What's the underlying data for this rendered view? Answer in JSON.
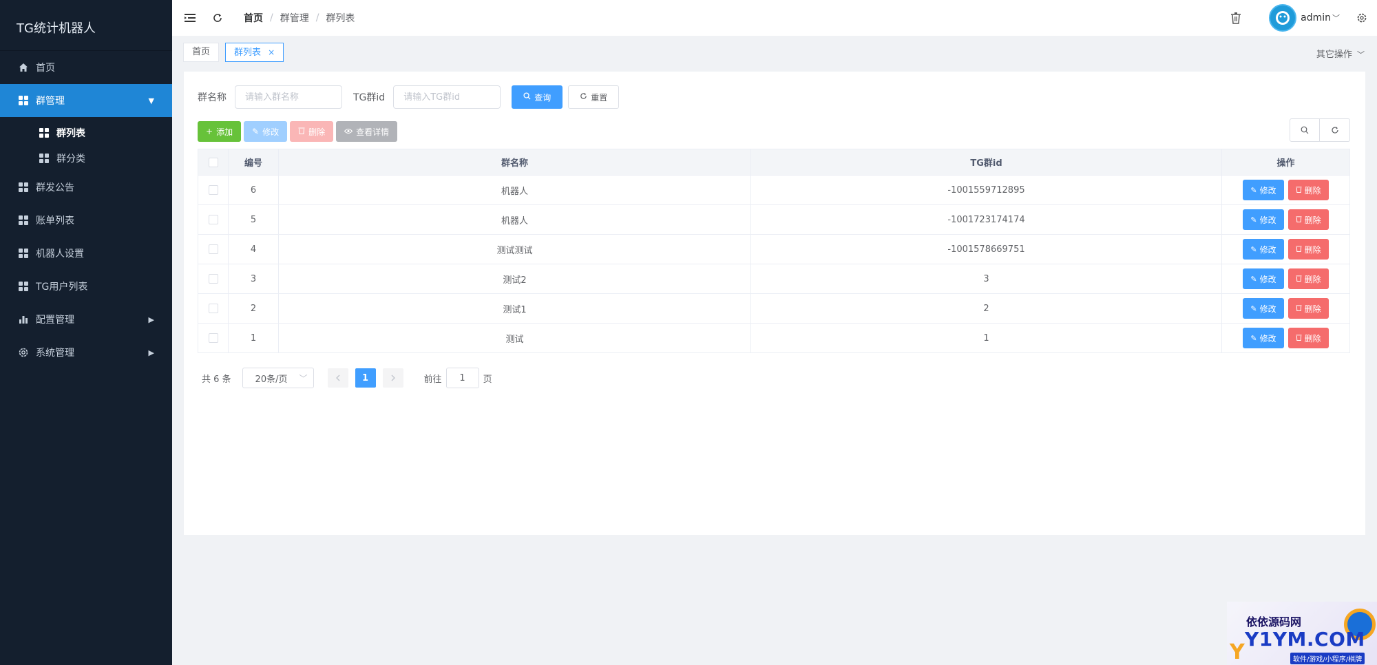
{
  "app": {
    "title": "TG统计机器人"
  },
  "sidebar": {
    "items": [
      {
        "label": "首页",
        "icon": "home-icon"
      },
      {
        "label": "群管理",
        "icon": "grid-icon",
        "expanded": true,
        "active": true
      },
      {
        "label": "群发公告",
        "icon": "grid-icon"
      },
      {
        "label": "账单列表",
        "icon": "grid-icon"
      },
      {
        "label": "机器人设置",
        "icon": "grid-icon"
      },
      {
        "label": "TG用户列表",
        "icon": "grid-icon"
      },
      {
        "label": "配置管理",
        "icon": "bar-chart-icon",
        "has_children": true
      },
      {
        "label": "系统管理",
        "icon": "gear-icon",
        "has_children": true
      }
    ],
    "sub_items": [
      {
        "label": "群列表",
        "active": true
      },
      {
        "label": "群分类"
      }
    ]
  },
  "header": {
    "breadcrumb": [
      "首页",
      "群管理",
      "群列表"
    ],
    "username": "admin"
  },
  "tags": {
    "items": [
      {
        "label": "首页"
      },
      {
        "label": "群列表",
        "active": true,
        "closable": true
      }
    ],
    "other_ops": "其它操作"
  },
  "search": {
    "name_label": "群名称",
    "name_placeholder": "请输入群名称",
    "id_label": "TG群id",
    "id_placeholder": "请输入TG群id",
    "query_label": "查询",
    "reset_label": "重置"
  },
  "toolbar": {
    "add_label": "添加",
    "edit_label": "修改",
    "delete_label": "删除",
    "view_label": "查看详情"
  },
  "table": {
    "columns": [
      "编号",
      "群名称",
      "TG群id",
      "操作"
    ],
    "rows": [
      {
        "id": "6",
        "name": "机器人",
        "tg_id": "-1001559712895"
      },
      {
        "id": "5",
        "name": "机器人",
        "tg_id": "-1001723174174"
      },
      {
        "id": "4",
        "name": "测试测试",
        "tg_id": "-1001578669751"
      },
      {
        "id": "3",
        "name": "测试2",
        "tg_id": "3"
      },
      {
        "id": "2",
        "name": "测试1",
        "tg_id": "2"
      },
      {
        "id": "1",
        "name": "测试",
        "tg_id": "1"
      }
    ],
    "edit_label": "修改",
    "delete_label": "删除"
  },
  "pagination": {
    "total_text": "共 6 条",
    "page_size": "20条/页",
    "current_page": "1",
    "goto_label": "前往",
    "goto_value": "1",
    "page_suffix": "页"
  },
  "watermark": {
    "line1": "依依源码网",
    "line2": "Y1YM.COM",
    "line3": "软件/游戏/小程序/棋牌"
  },
  "colors": {
    "sidebar_bg": "#141f2e",
    "active_menu": "#1f86d6",
    "primary": "#409eff",
    "success": "#67c23a",
    "danger": "#f56c6c"
  }
}
